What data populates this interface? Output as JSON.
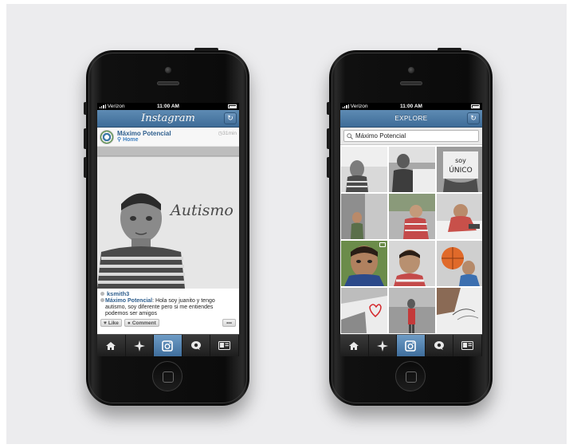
{
  "status_bar": {
    "carrier": "Verizon",
    "time": "11:00 AM"
  },
  "feed_screen": {
    "nav_title": "Instagram",
    "post": {
      "user": "Máximo Potencial",
      "location": "Home",
      "time_ago": "31min",
      "photo_text": "Autismo",
      "likes_user": "ksmith3",
      "caption_user": "Máximo Potencial",
      "caption_text": ": Hola soy juanito y tengo autismo, soy diferente pero si me entiendes podemos ser amigos"
    },
    "actions": {
      "like": "Like",
      "comment": "Comment",
      "more": "•••"
    }
  },
  "explore_screen": {
    "nav_title": "EXPLORE",
    "search_value": "Máximo Potencial",
    "tile_texts": {
      "sign_line1": "soy",
      "sign_line2": "ÚNICO"
    }
  },
  "tab_icons": [
    "home-icon",
    "explore-star-icon",
    "camera-icon",
    "news-bubble-icon",
    "profile-card-icon"
  ],
  "colors": {
    "nav_blue": "#3e6c98",
    "link_blue": "#2e5e8d",
    "tab_active": "#5a89b5"
  }
}
